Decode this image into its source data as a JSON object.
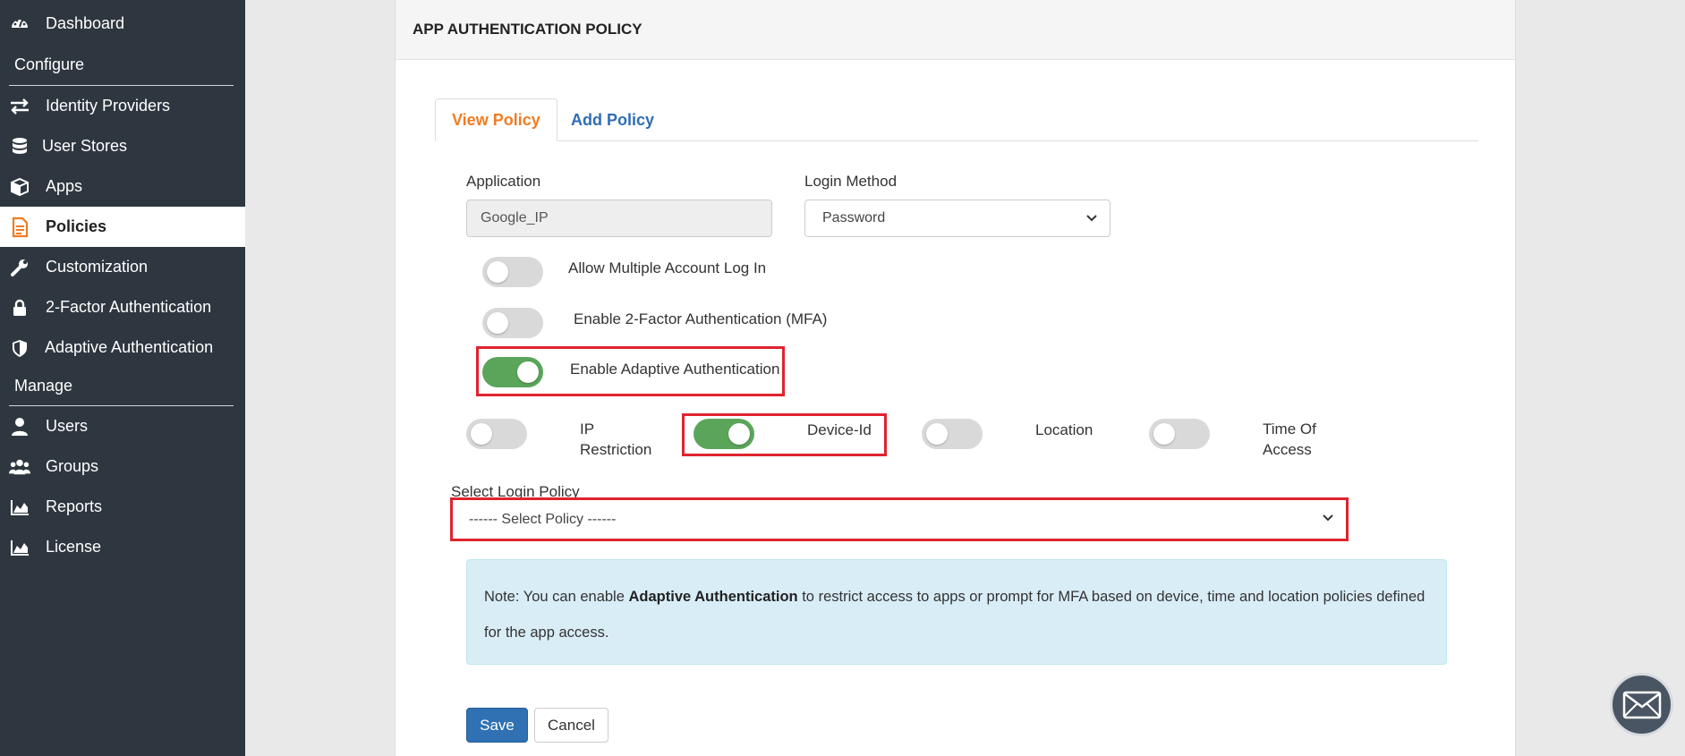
{
  "sidebar": {
    "items": [
      {
        "label": "Dashboard",
        "icon": "dashboard-gauge-icon"
      },
      {
        "label": "Identity Providers",
        "icon": "arrows-exchange-icon"
      },
      {
        "label": "User Stores",
        "icon": "database-icon"
      },
      {
        "label": "Apps",
        "icon": "cube-icon"
      },
      {
        "label": "Policies",
        "icon": "document-icon",
        "active": true
      },
      {
        "label": "Customization",
        "icon": "wrench-icon"
      },
      {
        "label": "2-Factor Authentication",
        "icon": "lock-icon"
      },
      {
        "label": "Adaptive Authentication",
        "icon": "shield-icon"
      },
      {
        "label": "Users",
        "icon": "user-icon"
      },
      {
        "label": "Groups",
        "icon": "users-group-icon"
      },
      {
        "label": "Reports",
        "icon": "area-chart-icon"
      },
      {
        "label": "License",
        "icon": "area-chart-icon"
      }
    ],
    "sections": {
      "configure": "Configure",
      "manage": "Manage"
    }
  },
  "card": {
    "title": "APP AUTHENTICATION POLICY"
  },
  "tabs": [
    {
      "label": "View Policy",
      "active": true
    },
    {
      "label": "Add Policy",
      "active": false
    }
  ],
  "form": {
    "application_label": "Application",
    "application_value": "Google_IP",
    "login_method_label": "Login Method",
    "login_method_value": "Password",
    "toggles": {
      "multiple_login": {
        "label": "Allow Multiple Account Log In",
        "on": false
      },
      "mfa": {
        "label": "Enable 2-Factor Authentication (MFA)",
        "on": false
      },
      "adaptive": {
        "label": "Enable Adaptive Authentication",
        "on": true
      },
      "ip_restriction": {
        "label_line1": "IP",
        "label_line2": "Restriction",
        "on": false
      },
      "device_id": {
        "label": "Device-Id",
        "on": true
      },
      "location": {
        "label": "Location",
        "on": false
      },
      "time_of_access": {
        "label_line1": "Time Of",
        "label_line2": "Access",
        "on": false
      }
    },
    "login_policy_label": "Select Login Policy",
    "login_policy_value": "------ Select Policy ------"
  },
  "note": {
    "prefix": "Note: You can enable ",
    "bold": "Adaptive Authentication",
    "suffix": " to restrict access to apps or prompt for MFA based on device, time and location policies defined for the app access."
  },
  "buttons": {
    "save": "Save",
    "cancel": "Cancel"
  },
  "colors": {
    "sidebar_bg": "#2e3740",
    "accent_orange": "#f07c22",
    "link_blue": "#2f6db5",
    "toggle_on": "#5ba55b",
    "highlight_red": "#e0232e",
    "note_bg": "#d9edf7",
    "primary_btn": "#2f71b3"
  },
  "floating": {
    "icon": "envelope-icon"
  }
}
